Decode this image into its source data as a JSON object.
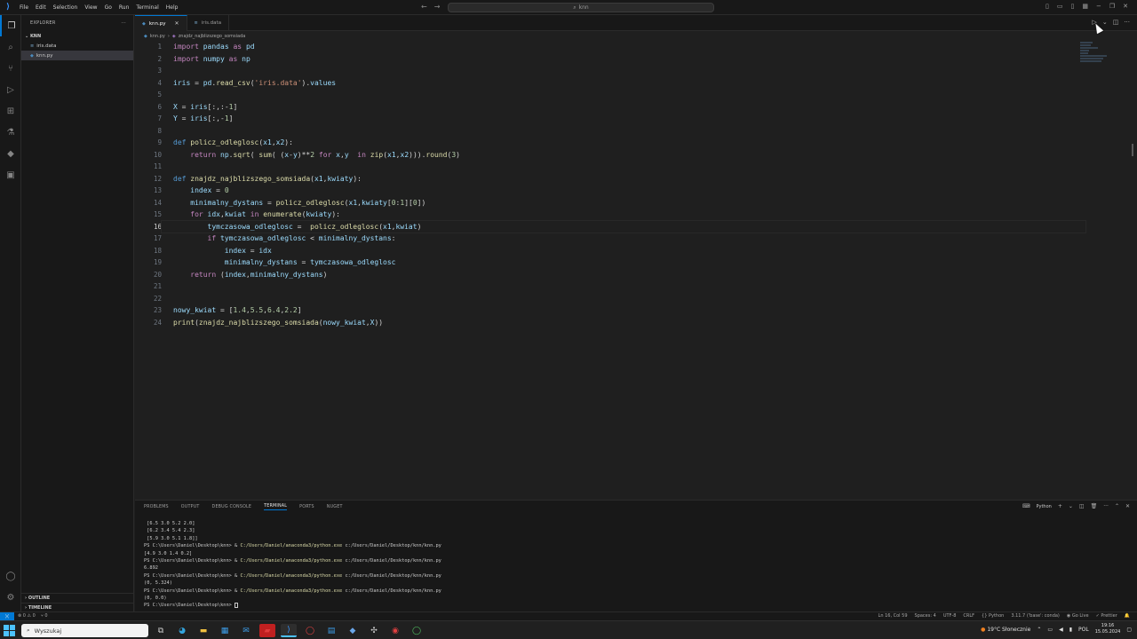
{
  "titlebar": {
    "menu": [
      "File",
      "Edit",
      "Selection",
      "View",
      "Go",
      "Run",
      "Terminal",
      "Help"
    ],
    "search": "knn"
  },
  "sidebar": {
    "title": "EXPLORER",
    "folder": "KNN",
    "files": [
      {
        "name": "iris.data",
        "selected": false
      },
      {
        "name": "knn.py",
        "selected": true
      }
    ],
    "outline": "OUTLINE",
    "timeline": "TIMELINE"
  },
  "tabs": [
    {
      "name": "knn.py",
      "active": true
    },
    {
      "name": "iris.data",
      "active": false
    }
  ],
  "breadcrumb": {
    "file": "knn.py",
    "symbol": "znajdz_najblizszego_somsiada"
  },
  "editor": {
    "current_line": 16,
    "lines": [
      "import pandas as pd",
      "import numpy as np",
      "",
      "iris = pd.read_csv('iris.data').values",
      "",
      "X = iris[:,:-1]",
      "Y = iris[:,-1]",
      "",
      "def policz_odleglosc(x1,x2):",
      "    return np.sqrt( sum( (x-y)**2 for x,y  in zip(x1,x2))).round(3)",
      "",
      "def znajdz_najblizszego_somsiada(x1,kwiaty):",
      "    index = 0",
      "    minimalny_dystans = policz_odleglosc(x1,kwiaty[0:1][0])",
      "    for idx,kwiat in enumerate(kwiaty):",
      "        tymczasowa_odleglosc =  policz_odleglosc(x1,kwiat)",
      "        if tymczasowa_odleglosc < minimalny_dystans:",
      "            index = idx",
      "            minimalny_dystans = tymczasowa_odleglosc",
      "    return (index,minimalny_dystans)",
      "",
      "",
      "nowy_kwiat = [1.4,5.5,6.4,2.2]",
      "print(znajdz_najblizszego_somsiada(nowy_kwiat,X))"
    ]
  },
  "panel": {
    "tabs": [
      "PROBLEMS",
      "OUTPUT",
      "DEBUG CONSOLE",
      "TERMINAL",
      "PORTS",
      "NUGET"
    ],
    "active_tab": "TERMINAL",
    "shell_label": "Python",
    "terminal_lines": [
      " [6.5 3.0 5.2 2.0]",
      " [6.2 3.4 5.4 2.3]",
      " [5.9 3.0 5.1 1.8]]",
      "PS C:\\Users\\Daniel\\Desktop\\knn> & C:/Users/Daniel/anaconda3/python.exe c:/Users/Daniel/Desktop/knn/knn.py",
      "[4.9 3.0 1.4 0.2]",
      "PS C:\\Users\\Daniel\\Desktop\\knn> & C:/Users/Daniel/anaconda3/python.exe c:/Users/Daniel/Desktop/knn/knn.py",
      "6.892",
      "PS C:\\Users\\Daniel\\Desktop\\knn> & C:/Users/Daniel/anaconda3/python.exe c:/Users/Daniel/Desktop/knn/knn.py",
      "(0, 5.324)",
      "PS C:\\Users\\Daniel\\Desktop\\knn> & C:/Users/Daniel/anaconda3/python.exe c:/Users/Daniel/Desktop/knn/knn.py",
      "(0, 0.0)",
      "PS C:\\Users\\Daniel\\Desktop\\knn> "
    ]
  },
  "statusbar": {
    "problems": "0 ⚠ 0",
    "ports": "0",
    "position": "Ln 16, Col 59",
    "spaces": "Spaces: 4",
    "encoding": "UTF-8",
    "eol": "CRLF",
    "language": "Python",
    "interpreter": "3.11.7 ('base': conda)",
    "golive": "Go Live",
    "prettier": "Prettier"
  },
  "taskbar": {
    "search_placeholder": "Wyszukaj",
    "weather": "19°C Słonecznie",
    "lang": "POL",
    "time": "19:16",
    "date": "15.05.2024"
  },
  "colors": {
    "accent": "#0078d4",
    "background": "#1f1f1f"
  }
}
